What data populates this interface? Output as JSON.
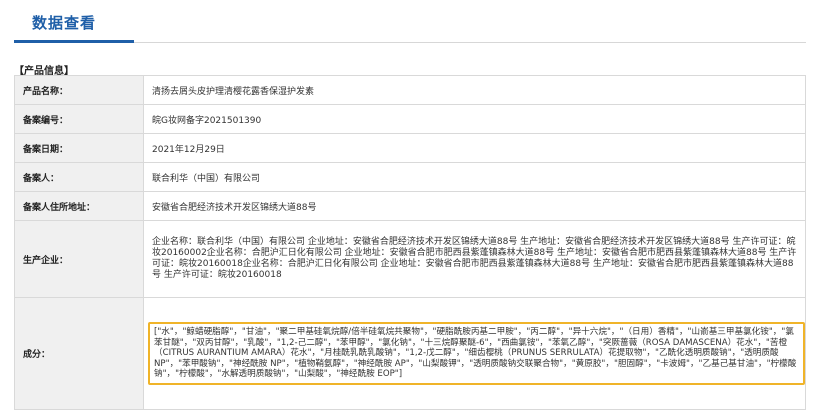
{
  "header": {
    "title": "数据查看"
  },
  "section": {
    "label": "【产品信息】"
  },
  "rows": [
    {
      "label": "产品名称：",
      "value": "清扬去屑头皮护理清樱花露香保湿护发素"
    },
    {
      "label": "备案编号：",
      "value": "皖G妆网备字2021501390"
    },
    {
      "label": "备案日期：",
      "value": "2021年12月29日"
    },
    {
      "label": "备案人：",
      "value": "联合利华（中国）有限公司"
    },
    {
      "label": "备案人住所地址：",
      "value": "安徽省合肥经济技术开发区锦绣大道88号"
    },
    {
      "label": "生产企业：",
      "value": "企业名称：联合利华（中国）有限公司 企业地址：安徽省合肥经济技术开发区锦绣大道88号 生产地址：安徽省合肥经济技术开发区锦绣大道88号 生产许可证：皖妆20160002企业名称：合肥沪汇日化有限公司 企业地址：安徽省合肥市肥西县紫蓬镇森林大道88号 生产地址：安徽省合肥市肥西县紫蓬镇森林大道88号 生产许可证：皖妆20160018企业名称：合肥沪汇日化有限公司 企业地址：安徽省合肥市肥西县紫蓬镇森林大道88号 生产地址：安徽省合肥市肥西县紫蓬镇森林大道88号 生产许可证：皖妆20160018"
    },
    {
      "label": "成分：",
      "value": "[\"水\"，\"鲸蜡硬脂醇\"，\"甘油\"，\"聚二甲基硅氧烷醇/倍半硅氧烷共聚物\"，\"硬脂酰胺丙基二甲胺\"，\"丙二醇\"，\"异十六烷\"，\"（日用）香精\"，\"山嵛基三甲基氯化铵\"，\"氯苯甘醚\"，\"双丙甘醇\"，\"乳酸\"，\"1,2-己二醇\"，\"苯甲醇\"，\"氯化钠\"，\"十三烷醇聚醚-6\"，\"西曲氯铵\"，\"苯氧乙醇\"，\"突厥蔷薇（ROSA DAMASCENA）花水\"，\"苦橙（CITRUS AURANTIUM AMARA）花水\"，\"月桂酰乳酰乳酸钠\"，\"1,2-戊二醇\"，\"细齿樱桃（PRUNUS SERRULATA）花提取物\"，\"乙酰化透明质酸钠\"，\"透明质酸 NP\"，\"苯甲酸钠\"，\"神经酰胺 NP\"，\"植物鞘氨醇\"，\"神经酰胺 AP\"，\"山梨酸钾\"，\"透明质酸钠交联聚合物\"，\"黄原胶\"，\"胆固醇\"，\"卡波姆\"，\"乙基己基甘油\"，\"柠檬酸钠\"，\"柠檬酸\"，\"水解透明质酸钠\"，\"山梨酸\"，\"神经酰胺 EOP\"]"
    }
  ]
}
